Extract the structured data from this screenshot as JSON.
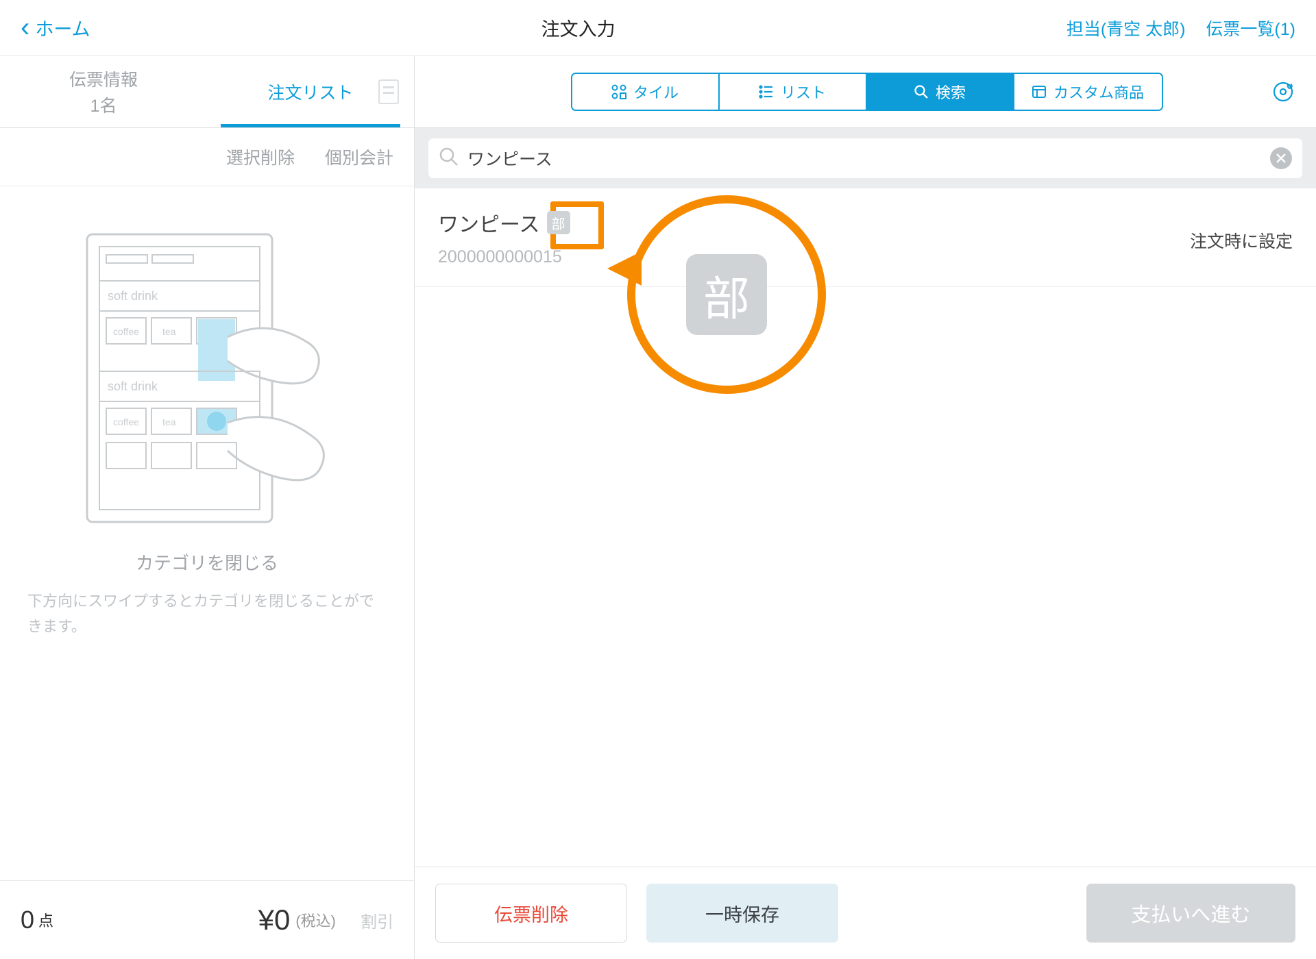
{
  "header": {
    "back_label": "ホーム",
    "title": "注文入力",
    "assignee": "担当(青空 太郎)",
    "slip_list": "伝票一覧(1)"
  },
  "left": {
    "tab_info_l1": "伝票情報",
    "tab_info_l2": "1名",
    "tab_order": "注文リスト",
    "action_delete": "選択削除",
    "action_split": "個別会計",
    "illus_title": "カテゴリを閉じる",
    "illus_desc": "下方向にスワイプするとカテゴリを閉じることができます。",
    "count_value": "0",
    "count_unit": "点",
    "price_value": "¥0",
    "price_tax": "(税込)",
    "discount": "割引",
    "illus_text": {
      "soft_drink": "soft drink",
      "coffee": "coffee",
      "tea": "tea"
    }
  },
  "right": {
    "views": {
      "tile": "タイル",
      "list": "リスト",
      "search": "検索",
      "custom": "カスタム商品"
    },
    "search_value": "ワンピース",
    "result": {
      "name": "ワンピース",
      "badge": "部",
      "code": "2000000000015",
      "note": "注文時に設定"
    },
    "callout_badge": "部",
    "footer": {
      "delete": "伝票削除",
      "save": "一時保存",
      "pay": "支払いへ進む"
    }
  }
}
